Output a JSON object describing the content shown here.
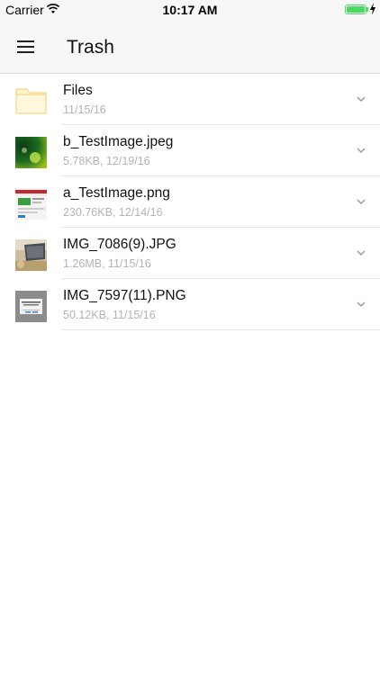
{
  "status_bar": {
    "carrier": "Carrier",
    "time": "10:17 AM",
    "battery_level": 1.0,
    "battery_color": "#4cd964"
  },
  "header": {
    "menu_icon": "hamburger-menu-icon",
    "title": "Trash"
  },
  "files": [
    {
      "name": "Files",
      "size": "",
      "date": "11/15/16",
      "thumb": "folder-icon"
    },
    {
      "name": "b_TestImage.jpeg",
      "size": "5.78KB",
      "date": "12/19/16",
      "thumb": "image-thumbnail"
    },
    {
      "name": "a_TestImage.png",
      "size": "230.76KB",
      "date": "12/14/16",
      "thumb": "image-thumbnail"
    },
    {
      "name": "IMG_7086(9).JPG",
      "size": "1.26MB",
      "date": "11/15/16",
      "thumb": "image-thumbnail"
    },
    {
      "name": "IMG_7597(11).PNG",
      "size": "50.12KB",
      "date": "11/15/16",
      "thumb": "image-thumbnail"
    }
  ],
  "row_action_icon": "chevron-down-icon",
  "colors": {
    "folder": "#fbeab0",
    "folder_edge": "#f2cf6c",
    "meta_text": "#b3b3b3",
    "divider": "#e6e6e6"
  }
}
